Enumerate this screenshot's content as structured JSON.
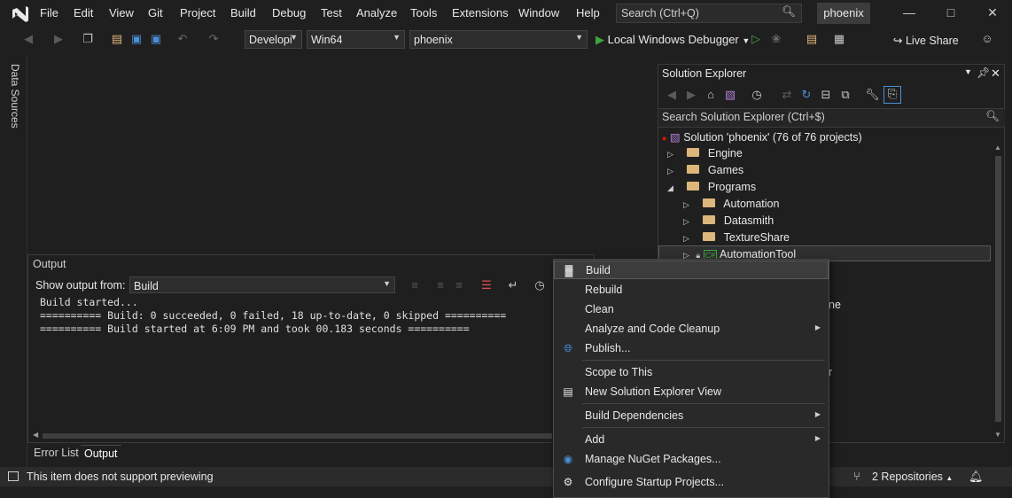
{
  "menubar": {
    "items": [
      "File",
      "Edit",
      "View",
      "Git",
      "Project",
      "Build",
      "Debug",
      "Test",
      "Analyze",
      "Tools",
      "Extensions",
      "Window",
      "Help"
    ],
    "search_placeholder": "Search (Ctrl+Q)",
    "project_name": "phoenix"
  },
  "toolbar": {
    "config": "Developi",
    "platform": "Win64",
    "startup": "phoenix",
    "debugger": "Local Windows Debugger",
    "live_share": "Live Share"
  },
  "left_strip": {
    "label": "Data Sources"
  },
  "solution_explorer": {
    "title": "Solution Explorer",
    "search_placeholder": "Search Solution Explorer (Ctrl+$)",
    "solution": "Solution 'phoenix' (76 of 76 projects)",
    "nodes": [
      "Engine",
      "Games",
      "Programs",
      "Automation",
      "Datasmith",
      "TextureShare",
      "AutomationTool"
    ],
    "partial_1": "ne",
    "partial_2": "r"
  },
  "output": {
    "title": "Output",
    "show_from_label": "Show output from:",
    "source": "Build",
    "lines": [
      "Build started...",
      "========== Build: 0 succeeded, 0 failed, 18 up-to-date, 0 skipped ==========",
      "========== Build started at 6:09 PM and took 00.183 seconds =========="
    ],
    "tabs": [
      "Error List",
      "Output"
    ]
  },
  "context_menu": {
    "items": [
      "Build",
      "Rebuild",
      "Clean",
      "Analyze and Code Cleanup",
      "Publish...",
      "Scope to This",
      "New Solution Explorer View",
      "Build Dependencies",
      "Add",
      "Manage NuGet Packages...",
      "Configure Startup Projects..."
    ]
  },
  "status": {
    "message": "This item does not support previewing",
    "repos": "2 Repositories"
  },
  "colors": {
    "accent": "#68217a",
    "play": "#3fa33f",
    "folder": "#dcb67a"
  }
}
